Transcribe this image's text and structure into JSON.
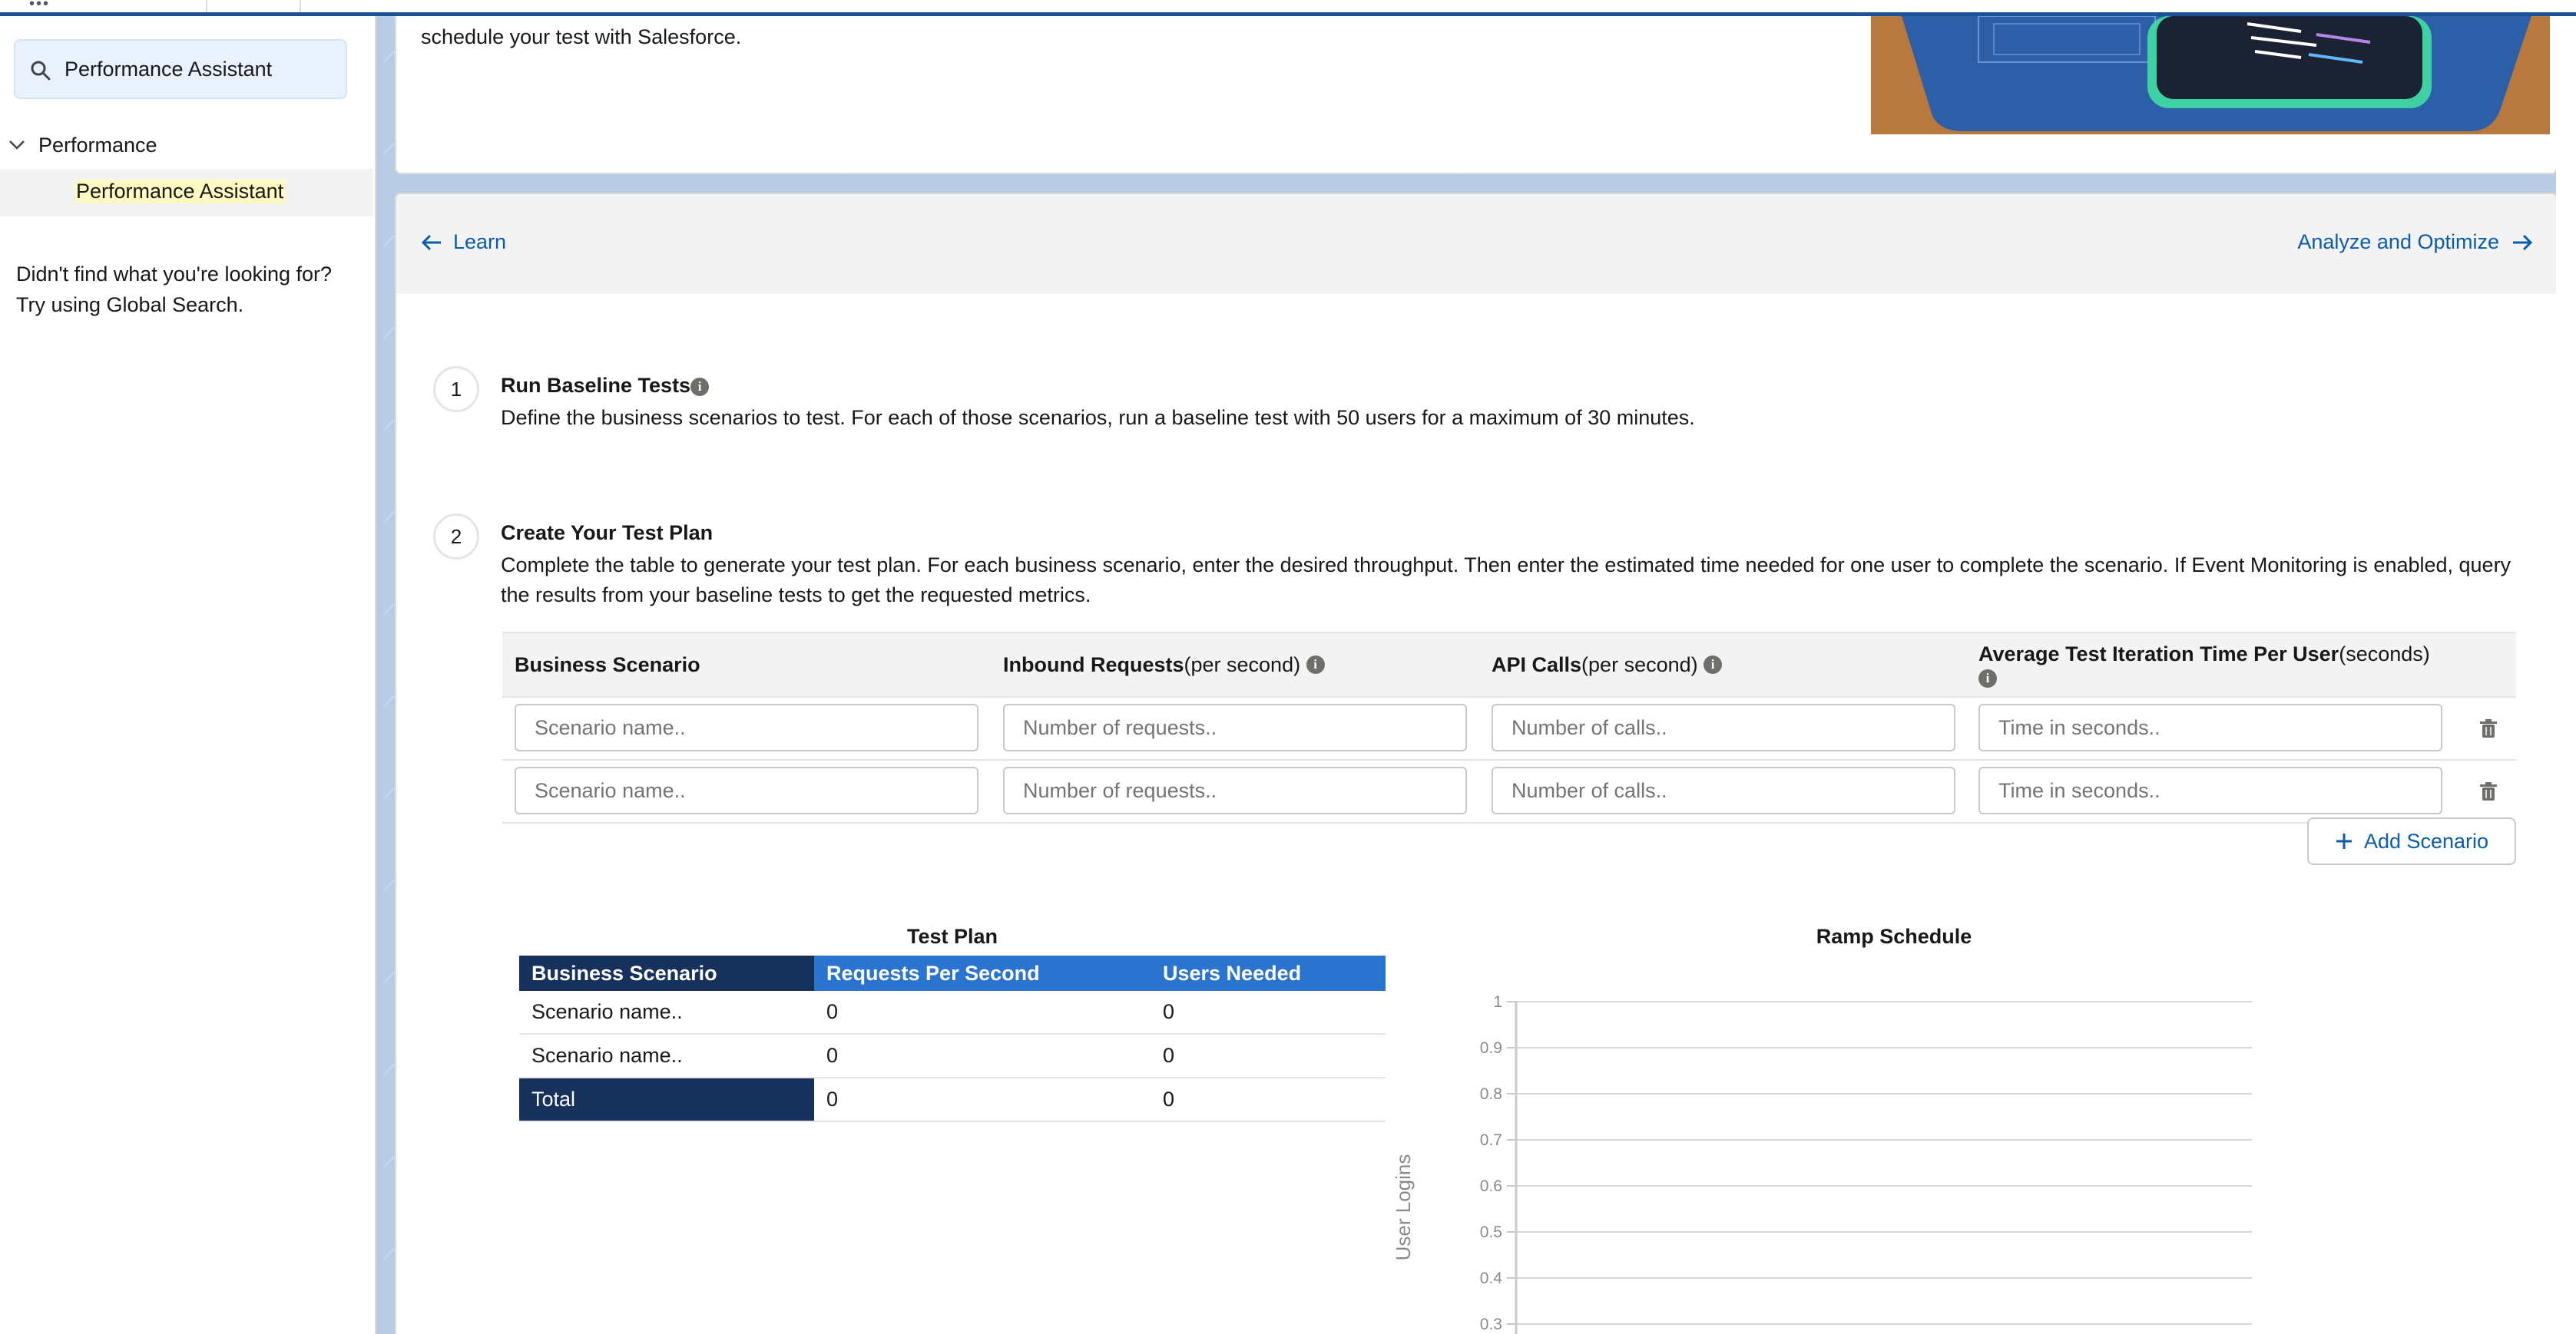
{
  "sidebar": {
    "search_value": "Performance Assistant",
    "tree_parent": "Performance",
    "tree_child": "Performance Assistant",
    "not_found_text": "Didn't find what you're looking for? Try using Global Search."
  },
  "intro": {
    "text": "schedule your test with Salesforce."
  },
  "nav": {
    "prev": "Learn",
    "next": "Analyze and Optimize"
  },
  "steps": [
    {
      "number": "1",
      "title": "Run Baseline Tests",
      "body": "Define the business scenarios to test. For each of those scenarios, run a baseline test with 50 users for a maximum of 30 minutes."
    },
    {
      "number": "2",
      "title": "Create Your Test Plan",
      "body": "Complete the table to generate your test plan. For each business scenario, enter the desired throughput. Then enter the estimated time needed for one user to complete the scenario. If Event Monitoring is enabled, query the results from your baseline tests to get the requested metrics."
    }
  ],
  "input_table": {
    "headers": [
      {
        "bold": "Business Scenario",
        "normal": ""
      },
      {
        "bold": "Inbound Requests",
        "normal": " (per second)"
      },
      {
        "bold": "API Calls",
        "normal": " (per second)"
      },
      {
        "bold": "Average Test Iteration Time Per User",
        "normal": " (seconds)"
      }
    ],
    "placeholders": [
      "Scenario name..",
      "Number of requests..",
      "Number of calls..",
      "Time in seconds.."
    ],
    "add_button": "Add Scenario"
  },
  "test_plan": {
    "title": "Test Plan",
    "headers": [
      "Business Scenario",
      "Requests Per Second",
      "Users Needed"
    ],
    "rows": [
      [
        "Scenario name..",
        "0",
        "0"
      ],
      [
        "Scenario name..",
        "0",
        "0"
      ]
    ],
    "total": [
      "Total",
      "0",
      "0"
    ]
  },
  "chart_data": {
    "type": "line",
    "title": "Ramp Schedule",
    "ylabel": "User Logins",
    "xlabel": "",
    "y_ticks": [
      "1",
      "0.9",
      "0.8",
      "0.7",
      "0.6",
      "0.5",
      "0.4",
      "0.3"
    ],
    "ylim": [
      0.3,
      1
    ],
    "grid": true,
    "series": []
  },
  "colors": {
    "brand_dark": "#16325c",
    "brand_blue": "#2a74d0",
    "link": "#0b5cab"
  }
}
